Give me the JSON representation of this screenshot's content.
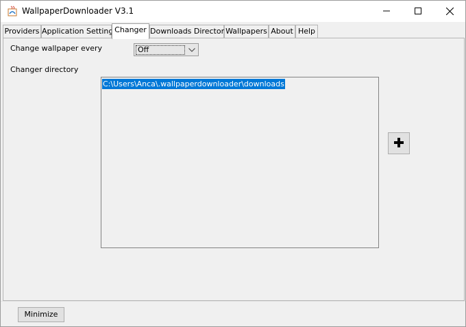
{
  "window": {
    "title": "WallpaperDownloader V3.1",
    "controls": {
      "minimize": "minimize-icon",
      "maximize": "maximize-icon",
      "close": "close-icon"
    }
  },
  "tabs": [
    {
      "label": "Providers",
      "selected": false
    },
    {
      "label": "Application Settings",
      "selected": false
    },
    {
      "label": "Changer",
      "selected": true
    },
    {
      "label": "Downloads Directory",
      "selected": false
    },
    {
      "label": "Wallpapers",
      "selected": false
    },
    {
      "label": "About",
      "selected": false
    },
    {
      "label": "Help",
      "selected": false
    }
  ],
  "changer": {
    "interval_label": "Change wallpaper every",
    "interval_value": "Off",
    "directory_label": "Changer directory",
    "directories": [
      "C:\\Users\\Anca\\.wallpaperdownloader\\downloads"
    ],
    "add_icon": "plus-icon"
  },
  "footer": {
    "minimize_label": "Minimize"
  },
  "colors": {
    "selection": "#0078d7",
    "panel_bg": "#f0f0f0",
    "titlebar_bg": "#ffffff"
  }
}
